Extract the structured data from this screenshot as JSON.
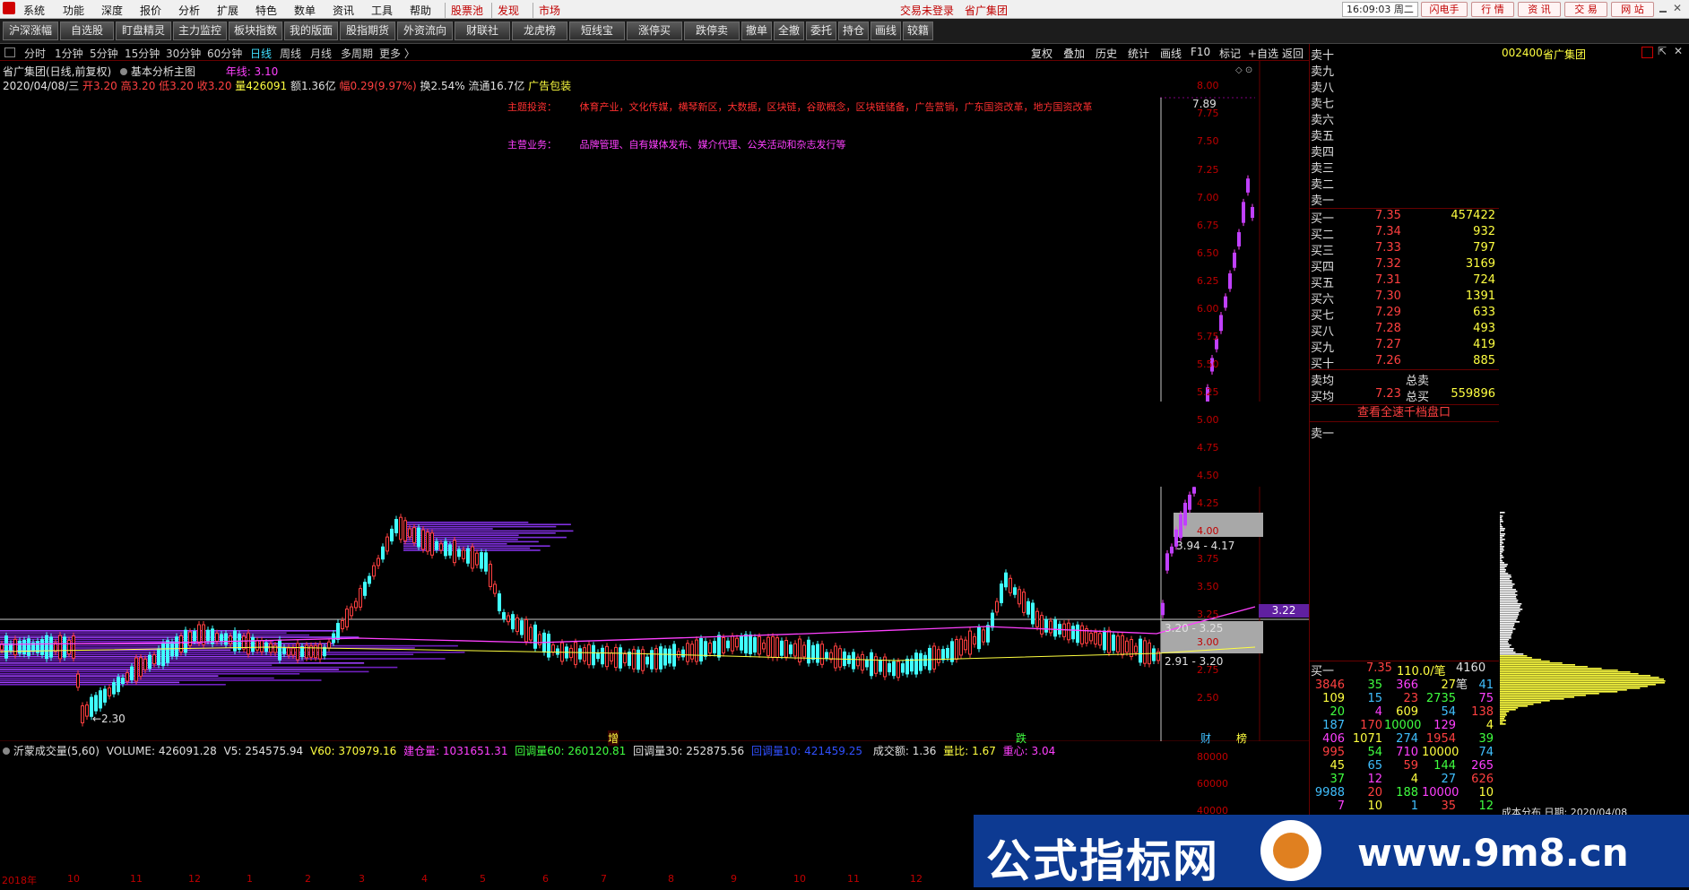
{
  "menu": [
    "系统",
    "功能",
    "深度",
    "报价",
    "分析",
    "扩展",
    "特色",
    "数单",
    "资讯",
    "工具",
    "帮助"
  ],
  "menu_highlight": [
    "股票池",
    "发现",
    "市场"
  ],
  "login_status": "交易未登录",
  "title_stock": "省广集团",
  "time": "16:09:03 周二",
  "right_buttons": [
    "闪电手",
    "行 情",
    "资 讯",
    "交 易",
    "网 站"
  ],
  "toolbar": [
    "沪深涨幅",
    "自选股",
    "盯盘精灵",
    "主力监控",
    "板块指数",
    "我的版面",
    "股指期货",
    "外资流向",
    "财联社",
    "龙虎榜",
    "短线宝",
    "涨停买",
    "跌停卖",
    "撤单",
    "全撤",
    "委托",
    "持仓",
    "画线",
    "较籍"
  ],
  "periods": [
    "分时",
    "1分钟",
    "5分钟",
    "15分钟",
    "30分钟",
    "60分钟",
    "日线",
    "周线",
    "月线",
    "多周期",
    "更多 〉"
  ],
  "active_period": "日线",
  "chart_tools": [
    "复权",
    "叠加",
    "历史",
    "统计",
    "画线",
    "F10",
    "标记",
    "+自选",
    "返回"
  ],
  "chart_title": "省广集团(日线,前复权)",
  "main_indicator": "基本分析主图",
  "year_line": "年线: 3.10",
  "quote": {
    "date": "2020/04/08/三",
    "open": "开3.20",
    "high": "高3.20",
    "low": "低3.20",
    "close": "收3.20",
    "volume": "量426091",
    "amount": "额1.36亿",
    "change": "幅0.29(9.97%)",
    "turnover": "换2.54%",
    "float": "流通16.7亿",
    "industry": "广告包装"
  },
  "theme_label": "主题投资：",
  "theme_text": "体育产业，文化传媒，横琴新区，大数据，区块链，谷歌概念，区块链储备，广告营销，广东国资改革，地方国资改革",
  "business_label": "主营业务：",
  "business_text": "品牌管理、自有媒体发布、媒介代理、公关活动和杂志发行等",
  "price_axis": [
    "8.00",
    "7.75",
    "7.50",
    "7.25",
    "7.00",
    "6.75",
    "6.50",
    "6.25",
    "6.00",
    "5.75",
    "5.50",
    "5.25",
    "5.00",
    "4.75",
    "4.50",
    "4.25",
    "4.00",
    "3.75",
    "3.50",
    "3.25",
    "3.00",
    "2.75",
    "2.50"
  ],
  "current_price_tag": "3.22",
  "annotations": {
    "high_mark": "7.89",
    "low_mark": "←2.30",
    "range_upper": "3.94 - 4.17",
    "range_mid": "3.20 - 3.25",
    "range_lower": "2.91 - 3.20"
  },
  "event_marks": [
    "增",
    "跌",
    "财",
    "榜"
  ],
  "volume_indicator": {
    "name": "沂蒙成交量(5,60)",
    "volume": "VOLUME: 426091.28",
    "v5": "V5: 254575.94",
    "v60": "V60: 370979.16",
    "build": "建仓量: 1031651.31",
    "pull60": "回调量60: 260120.81",
    "pull30": "回调量30: 252875.56",
    "pull10": "回调量10: 421459.25",
    "amount": "成交额: 1.36",
    "ratio": "量比: 1.67",
    "center": "重心: 3.04"
  },
  "vol_axis": [
    "80000",
    "60000",
    "40000"
  ],
  "time_axis": [
    "2018年",
    "10",
    "11",
    "12",
    "1",
    "2",
    "3",
    "4",
    "5",
    "6",
    "7",
    "8",
    "9",
    "10",
    "11",
    "12"
  ],
  "orderbook": {
    "stock_code": "002400",
    "stock_name": "省广集团",
    "asks": [
      "卖十",
      "卖九",
      "卖八",
      "卖七",
      "卖六",
      "卖五",
      "卖四",
      "卖三",
      "卖二",
      "卖一"
    ],
    "bids": [
      {
        "label": "买一",
        "price": "7.35",
        "vol": "457422"
      },
      {
        "label": "买二",
        "price": "7.34",
        "vol": "932"
      },
      {
        "label": "买三",
        "price": "7.33",
        "vol": "797"
      },
      {
        "label": "买四",
        "price": "7.32",
        "vol": "3169"
      },
      {
        "label": "买五",
        "price": "7.31",
        "vol": "724"
      },
      {
        "label": "买六",
        "price": "7.30",
        "vol": "1391"
      },
      {
        "label": "买七",
        "price": "7.29",
        "vol": "633"
      },
      {
        "label": "买八",
        "price": "7.28",
        "vol": "493"
      },
      {
        "label": "买九",
        "price": "7.27",
        "vol": "419"
      },
      {
        "label": "买十",
        "price": "7.26",
        "vol": "885"
      }
    ],
    "sell_avg_label": "卖均",
    "total_sell_label": "总卖",
    "buy_avg_label": "买均",
    "buy_avg": "7.23",
    "total_buy_label": "总买",
    "total_buy": "559896",
    "thousand_link": "查看全速千档盘口",
    "ask1_label": "卖一",
    "bid1_row": {
      "label": "买一",
      "price": "7.35",
      "per": "110.0/笔",
      "count": "4160笔"
    },
    "ticks": [
      [
        "3846",
        "35",
        "366",
        "27",
        "41"
      ],
      [
        "109",
        "15",
        "23",
        "2735",
        "75"
      ],
      [
        "20",
        "4",
        "609",
        "54",
        "138"
      ],
      [
        "187",
        "170",
        "10000",
        "129",
        "4"
      ],
      [
        "406",
        "1071",
        "274",
        "1954",
        "39"
      ],
      [
        "995",
        "54",
        "710",
        "10000",
        "74"
      ],
      [
        "45",
        "65",
        "59",
        "144",
        "265"
      ],
      [
        "37",
        "12",
        "4",
        "27",
        "626"
      ],
      [
        "9988",
        "20",
        "188",
        "10000",
        "10"
      ],
      [
        "7",
        "10",
        "1",
        "35",
        "12"
      ]
    ],
    "cost_dist": "成本分布 日期: 2020/04/08"
  },
  "watermark": {
    "text": "公式指标网",
    "url": "www.9m8.cn"
  }
}
